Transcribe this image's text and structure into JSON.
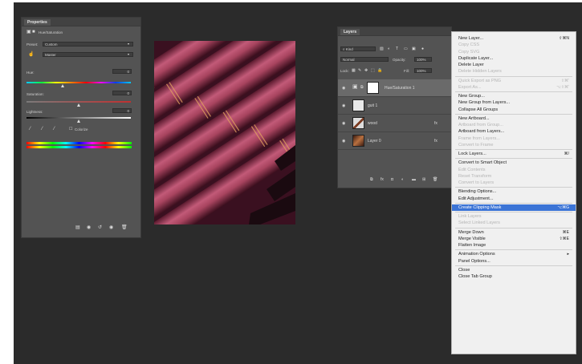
{
  "properties": {
    "tab": "Properties",
    "adjustment_name": "Hue/Saturation",
    "preset_label": "Preset:",
    "preset_value": "Custom",
    "channel_value": "Master",
    "hue_label": "Hue:",
    "hue_value": "0",
    "saturation_label": "Saturation:",
    "saturation_value": "0",
    "lightness_label": "Lightness:",
    "lightness_value": "0",
    "colorize_label": "Colorize",
    "colorize_checked": false
  },
  "layers": {
    "tab": "Layers",
    "filter_kind": "Kind",
    "blend_mode": "Normal",
    "opacity_label": "Opacity:",
    "opacity_value": "100%",
    "lock_label": "Lock:",
    "fill_label": "Fill:",
    "fill_value": "100%",
    "rows": [
      {
        "name": "Hue/Saturation 1",
        "selected": true
      },
      {
        "name": "guit 1",
        "selected": false
      },
      {
        "name": "wood",
        "selected": false,
        "fx": "fx"
      },
      {
        "name": "Layer 0",
        "selected": false,
        "fx": "fx"
      }
    ]
  },
  "context_menu": {
    "items": [
      {
        "label": "New Layer...",
        "shortcut": "⇧⌘N",
        "enabled": true
      },
      {
        "label": "Copy CSS",
        "shortcut": "",
        "enabled": false
      },
      {
        "label": "Copy SVG",
        "shortcut": "",
        "enabled": false
      },
      {
        "label": "Duplicate Layer...",
        "shortcut": "",
        "enabled": true
      },
      {
        "label": "Delete Layer",
        "shortcut": "",
        "enabled": true
      },
      {
        "label": "Delete Hidden Layers",
        "shortcut": "",
        "enabled": false
      },
      {
        "sep": true
      },
      {
        "label": "Quick Export as PNG",
        "shortcut": "⇧⌘'",
        "enabled": false
      },
      {
        "label": "Export As...",
        "shortcut": "⌥⇧⌘'",
        "enabled": false
      },
      {
        "sep": true
      },
      {
        "label": "New Group...",
        "shortcut": "",
        "enabled": true
      },
      {
        "label": "New Group from Layers...",
        "shortcut": "",
        "enabled": true
      },
      {
        "label": "Collapse All Groups",
        "shortcut": "",
        "enabled": true
      },
      {
        "sep": true
      },
      {
        "label": "New Artboard...",
        "shortcut": "",
        "enabled": true
      },
      {
        "label": "Artboard from Group...",
        "shortcut": "",
        "enabled": false
      },
      {
        "label": "Artboard from Layers...",
        "shortcut": "",
        "enabled": true
      },
      {
        "label": "Frame from Layers...",
        "shortcut": "",
        "enabled": false
      },
      {
        "label": "Convert to Frame",
        "shortcut": "",
        "enabled": false
      },
      {
        "sep": true
      },
      {
        "label": "Lock Layers...",
        "shortcut": "⌘/",
        "enabled": true
      },
      {
        "sep": true
      },
      {
        "label": "Convert to Smart Object",
        "shortcut": "",
        "enabled": true
      },
      {
        "label": "Edit Contents",
        "shortcut": "",
        "enabled": false
      },
      {
        "label": "Reset Transform",
        "shortcut": "",
        "enabled": false
      },
      {
        "label": "Convert to Layers",
        "shortcut": "",
        "enabled": false
      },
      {
        "sep": true
      },
      {
        "label": "Blending Options...",
        "shortcut": "",
        "enabled": true
      },
      {
        "label": "Edit Adjustment...",
        "shortcut": "",
        "enabled": true
      },
      {
        "sep": true
      },
      {
        "label": "Create Clipping Mask",
        "shortcut": "⌥⌘G",
        "enabled": true,
        "highlighted": true
      },
      {
        "sep": true
      },
      {
        "label": "Link Layers",
        "shortcut": "",
        "enabled": false
      },
      {
        "label": "Select Linked Layers",
        "shortcut": "",
        "enabled": false
      },
      {
        "sep": true
      },
      {
        "label": "Merge Down",
        "shortcut": "⌘E",
        "enabled": true
      },
      {
        "label": "Merge Visible",
        "shortcut": "⇧⌘E",
        "enabled": true
      },
      {
        "label": "Flatten Image",
        "shortcut": "",
        "enabled": true
      },
      {
        "sep": true
      },
      {
        "label": "Animation Options",
        "shortcut": "▸",
        "enabled": true
      },
      {
        "label": "Panel Options...",
        "shortcut": "",
        "enabled": true
      },
      {
        "sep": true
      },
      {
        "label": "Close",
        "shortcut": "",
        "enabled": true
      },
      {
        "label": "Close Tab Group",
        "shortcut": "",
        "enabled": true
      }
    ]
  },
  "colors": {
    "workspace": "#2b2b2b",
    "panel": "#535353",
    "menu_highlight": "#3b74d6",
    "canvas_base": "#6b2238"
  }
}
